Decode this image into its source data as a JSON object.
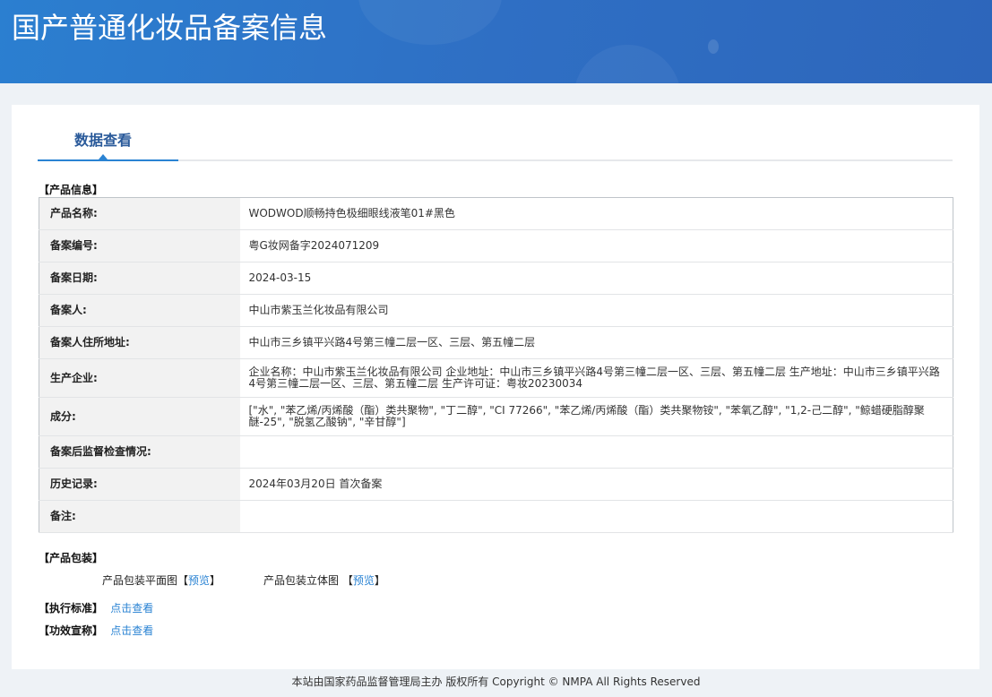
{
  "header": {
    "title": "国产普通化妆品备案信息"
  },
  "tab": {
    "label": "数据查看"
  },
  "product_info": {
    "section_title": "【产品信息】",
    "rows": [
      {
        "label": "产品名称:",
        "value": "WODWOD顺畅持色极细眼线液笔01#黑色"
      },
      {
        "label": "备案编号:",
        "value": "粤G妆网备字2024071209"
      },
      {
        "label": "备案日期:",
        "value": "2024-03-15"
      },
      {
        "label": "备案人:",
        "value": "中山市紫玉兰化妆品有限公司"
      },
      {
        "label": "备案人住所地址:",
        "value": "中山市三乡镇平兴路4号第三幢二层一区、三层、第五幢二层"
      },
      {
        "label": "生产企业:",
        "value": "企业名称：中山市紫玉兰化妆品有限公司 企业地址：中山市三乡镇平兴路4号第三幢二层一区、三层、第五幢二层 生产地址：中山市三乡镇平兴路4号第三幢二层一区、三层、第五幢二层 生产许可证：粤妆20230034"
      },
      {
        "label": "成分:",
        "value": "[\"水\", \"苯乙烯/丙烯酸（酯）类共聚物\", \"丁二醇\", \"CI 77266\", \"苯乙烯/丙烯酸（酯）类共聚物铵\", \"苯氧乙醇\", \"1,2-己二醇\", \"鲸蜡硬脂醇聚醚-25\", \"脱氢乙酸钠\", \"辛甘醇\"]"
      },
      {
        "label": "备案后监督检查情况:",
        "value": ""
      },
      {
        "label": "历史记录:",
        "value": "2024年03月20日 首次备案"
      },
      {
        "label": "备注:",
        "value": ""
      }
    ]
  },
  "packaging": {
    "section_title": "【产品包装】",
    "flat_label": "产品包装平面图",
    "solid_label": "产品包装立体图",
    "preview": "预览",
    "open": "【",
    "close": "】"
  },
  "standard": {
    "label": "【执行标准】",
    "link": "点击查看"
  },
  "efficacy": {
    "label": "【功效宣称】",
    "link": "点击查看"
  },
  "footer": {
    "text": "本站由国家药品监督管理局主办 版权所有 Copyright © NMPA All Rights Reserved"
  }
}
